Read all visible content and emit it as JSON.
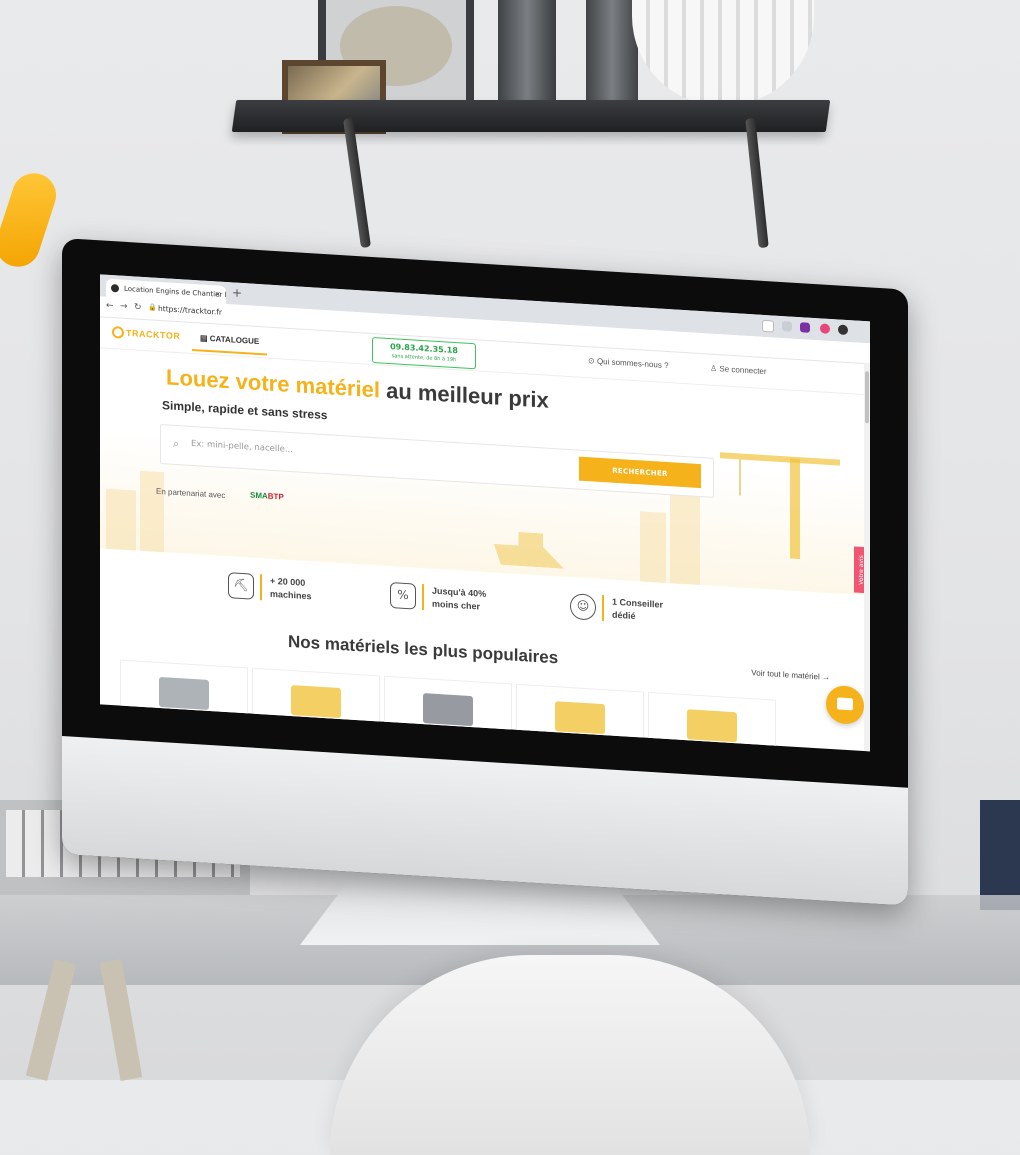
{
  "browser": {
    "tab_title": "Location Engins de Chantier l",
    "tab_close": "×",
    "new_tab": "+",
    "url": "https://tracktor.fr"
  },
  "site": {
    "logo": "TRACKTOR",
    "nav_catalogue": "CATALOGUE",
    "phone_number": "09.83.42.35.18",
    "phone_note": "sans attente, de 8h à 19h",
    "link_about": "Qui sommes-nous ?",
    "link_login": "Se connecter"
  },
  "hero": {
    "title_accent": "Louez votre matériel",
    "title_rest": "au meilleur prix",
    "subtitle": "Simple, rapide et sans stress",
    "search_placeholder": "Ex: mini-pelle, nacelle...",
    "search_button": "RECHERCHER",
    "partner_text": "En partenariat avec",
    "partner_logo_green": "SMA",
    "partner_logo_red": "BTP",
    "feedback_tab": "Votre avis"
  },
  "features": [
    {
      "line1": "+ 20 000",
      "line2": "machines",
      "icon": "excavator-icon"
    },
    {
      "line1": "Jusqu'à 40%",
      "line2": "moins cher",
      "icon": "price-tag-icon"
    },
    {
      "line1": "1 Conseiller",
      "line2": "dédié",
      "icon": "advisor-icon"
    }
  ],
  "popular": {
    "title": "Nos matériels les plus populaires",
    "see_all": "Voir tout le matériel →"
  },
  "colors": {
    "brand_yellow": "#f5b21a",
    "phone_green": "#26a646",
    "feedback_pink": "#f05672",
    "accent_orange": "#ffc83a"
  }
}
